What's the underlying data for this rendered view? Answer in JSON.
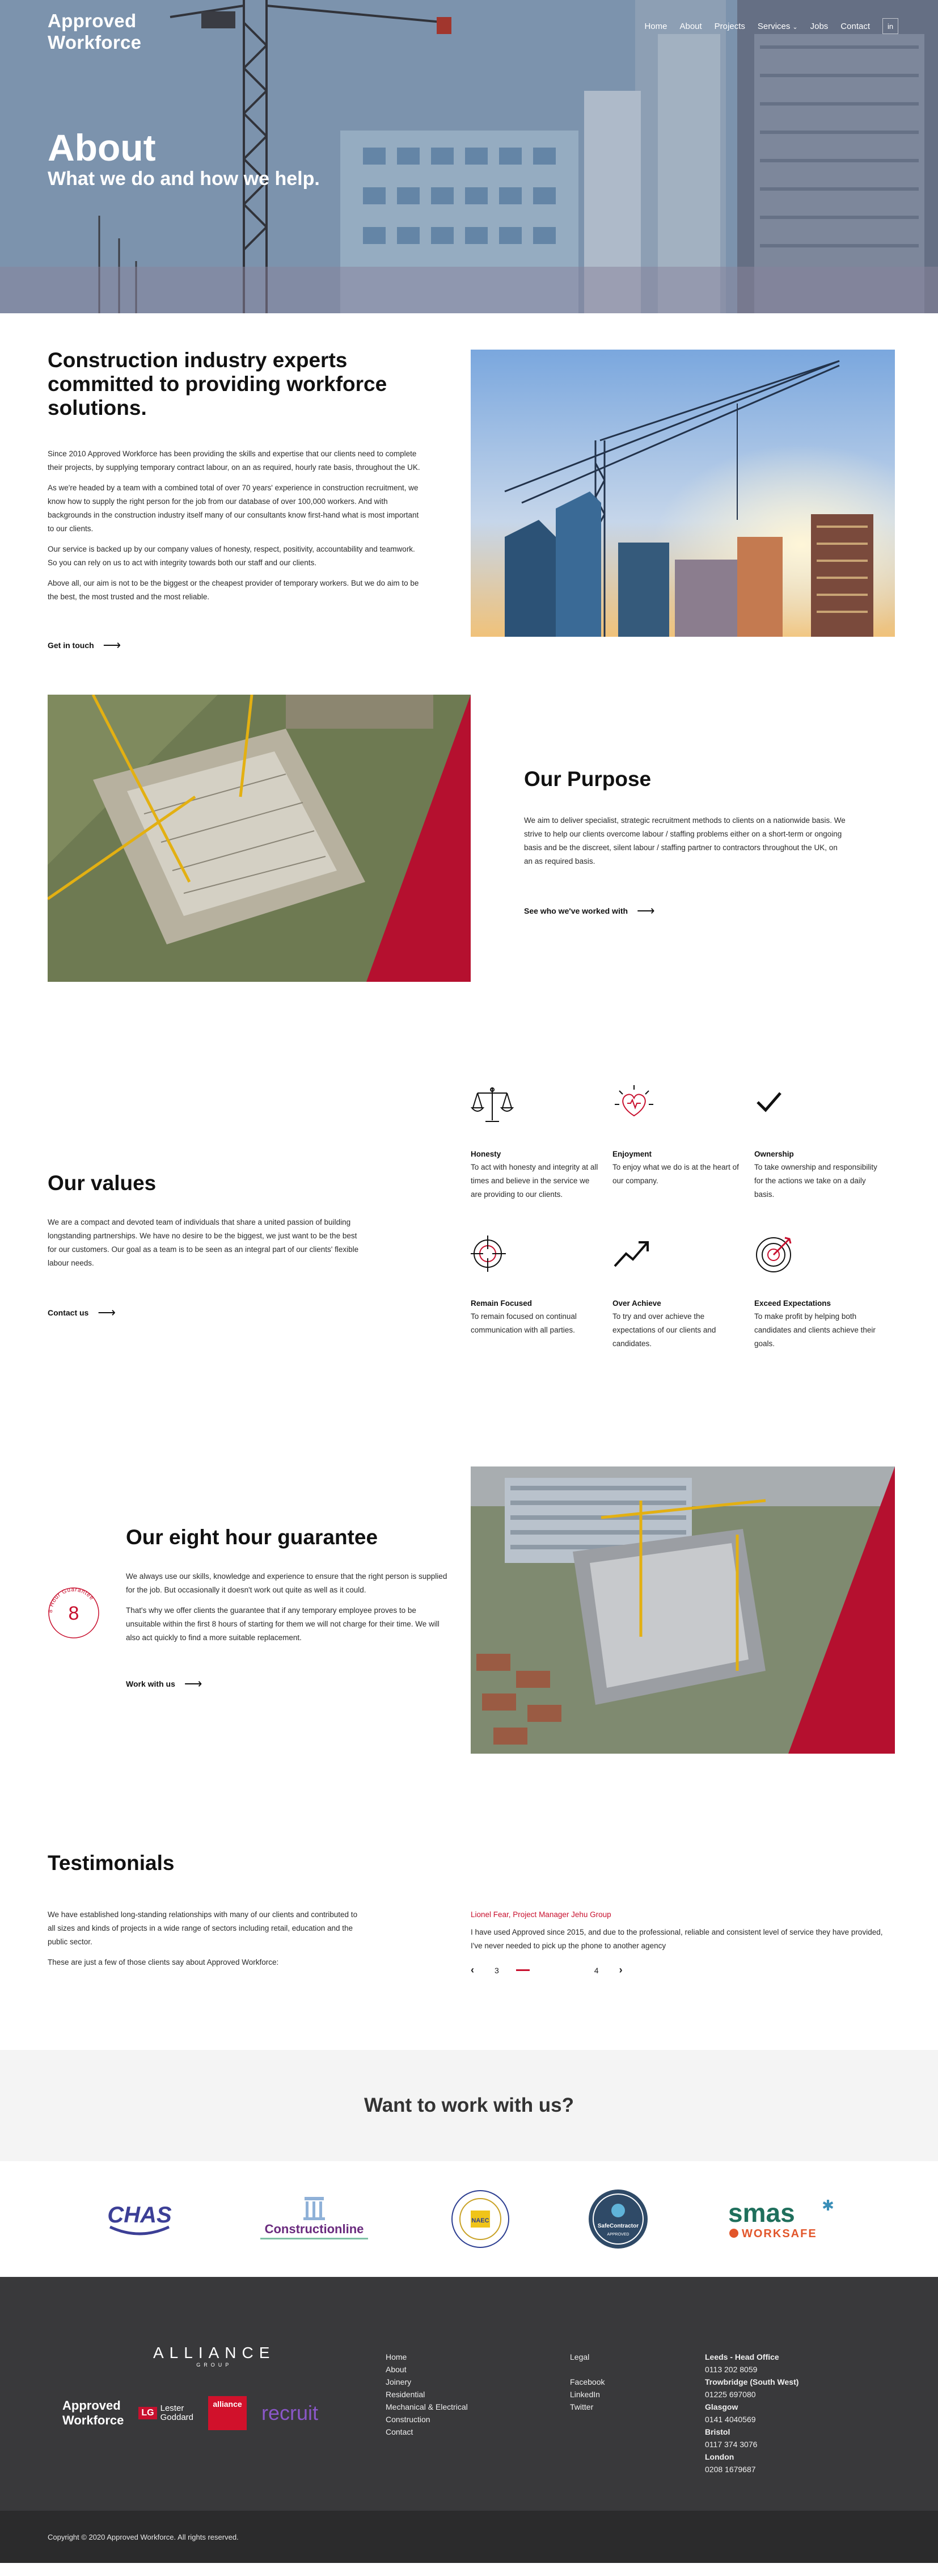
{
  "header": {
    "logo_line1": "Approved",
    "logo_line2": "Workforce",
    "nav": [
      "Home",
      "About",
      "Projects",
      "Services",
      "Jobs",
      "Contact"
    ],
    "menu_icon": "linkedin-icon"
  },
  "hero": {
    "title": "About",
    "subtitle": "What we do and how we help."
  },
  "intro": {
    "heading": "Construction industry experts committed to providing workforce solutions.",
    "paragraphs": [
      "Since 2010 Approved Workforce has been providing the skills and expertise that our clients need to complete their projects, by supplying temporary contract labour, on an as required, hourly rate basis, throughout the UK.",
      "As we're headed by a team with a combined total of over 70 years' experience in construction recruitment, we know how to supply the right person for the job from our database of over 100,000 workers. And with backgrounds in the construction industry itself many of our consultants know first-hand what is most important to our clients.",
      "Our service is backed up by our company values of honesty, respect, positivity, accountability and teamwork. So you can rely on us to act with integrity towards both our staff and our clients.",
      "Above all, our aim is not to be the biggest or the cheapest provider of temporary workers. But we do aim to be the best, the most trusted and the most reliable."
    ],
    "cta": "Get in touch"
  },
  "purpose": {
    "heading": "Our Purpose",
    "body": "We aim to deliver specialist, strategic recruitment methods to clients on a nationwide basis. We strive to help our clients overcome labour / staffing problems either on a short-term or ongoing basis and be the discreet, silent labour / staffing partner to contractors throughout the UK, on an as required basis.",
    "cta": "See who we've worked with"
  },
  "values": {
    "heading": "Our values",
    "body": "We are a compact and devoted team of individuals that share a united passion of building longstanding partnerships. We have no desire to be the biggest, we just want to be the best for our customers. Our goal as a team is to be seen as an integral part of our clients' flexible labour needs.",
    "cta": "Contact us",
    "items": [
      {
        "title": "Honesty",
        "text": "To act with honesty and integrity at all times and believe in the service we are providing to our clients.",
        "icon": "scales-icon"
      },
      {
        "title": "Enjoyment",
        "text": "To enjoy what we do is at the heart of our company.",
        "icon": "heart-icon"
      },
      {
        "title": "Ownership",
        "text": "To take ownership and responsibility for the actions we take on a daily basis.",
        "icon": "checkmark-icon"
      },
      {
        "title": "Remain Focused",
        "text": "To remain focused on continual communication with all parties.",
        "icon": "crosshair-icon"
      },
      {
        "title": "Over Achieve",
        "text": "To try and over achieve the expectations of our clients and candidates.",
        "icon": "trend-up-icon"
      },
      {
        "title": "Exceed Expectations",
        "text": "To make profit by helping both candidates and clients achieve their goals.",
        "icon": "target-icon"
      }
    ],
    "accent": "#c8102e"
  },
  "guarantee": {
    "heading": "Our eight hour guarantee",
    "badge_number": "8",
    "badge_text": "8 Hour Guarantee",
    "paragraphs": [
      "We always use our skills, knowledge and experience to ensure that the right person is supplied for the job. But occasionally it doesn't work out quite as well as it could.",
      "That's why we offer clients the guarantee that if any temporary employee proves to be unsuitable within the first 8 hours of starting for them we will not charge for their time. We will also act quickly to find a more suitable replacement."
    ],
    "cta": "Work with us"
  },
  "testimonials": {
    "heading": "Testimonials",
    "paragraphs": [
      "We have established long-standing relationships with many of our clients and contributed to all sizes and kinds of projects in a wide range of sectors including retail, education and the public sector.",
      "These are just a few of those clients say about Approved Workforce:"
    ],
    "author": "Lionel Fear, Project Manager Jehu Group",
    "quote": "I have used Approved since 2015, and due to the professional, reliable and consistent level of service they have provided, I've never needed to pick up the phone to another agency",
    "current": "3",
    "total": "4"
  },
  "cta_band": {
    "heading": "Want to work with us?"
  },
  "accreditations": {
    "chas": "CHAS",
    "constructionline": "Constructionline",
    "naec": "NAEC",
    "safecontractor": "SafeContractor",
    "safecontractor_sub": "APPROVED",
    "smas": "smas",
    "smas_sub": "WORKSAFE"
  },
  "footer": {
    "alliance": "ALLIANCE",
    "alliance_sub": "GROUP",
    "brand_approved_1": "Approved",
    "brand_approved_2": "Workforce",
    "brand_lester_1": "Lester",
    "brand_lester_2": "Goddard",
    "brand_alliance": "alliance",
    "brand_recruit": "recruit",
    "links": [
      "Home",
      "About",
      "Joinery",
      "Residential",
      "Mechanical & Electrical",
      "Construction",
      "Contact"
    ],
    "legal_heading": "Legal",
    "social": [
      "Facebook",
      "LinkedIn",
      "Twitter"
    ],
    "offices": [
      {
        "name": "Leeds - Head Office",
        "phone": "0113 202 8059"
      },
      {
        "name": "Trowbridge (South West)",
        "phone": "01225 697080"
      },
      {
        "name": "Glasgow",
        "phone": "0141 4040569"
      },
      {
        "name": "Bristol",
        "phone": "0117 374 3076"
      },
      {
        "name": "London",
        "phone": "0208 1679687"
      }
    ],
    "copyright": "Copyright © 2020 Approved Workforce. All rights reserved."
  }
}
